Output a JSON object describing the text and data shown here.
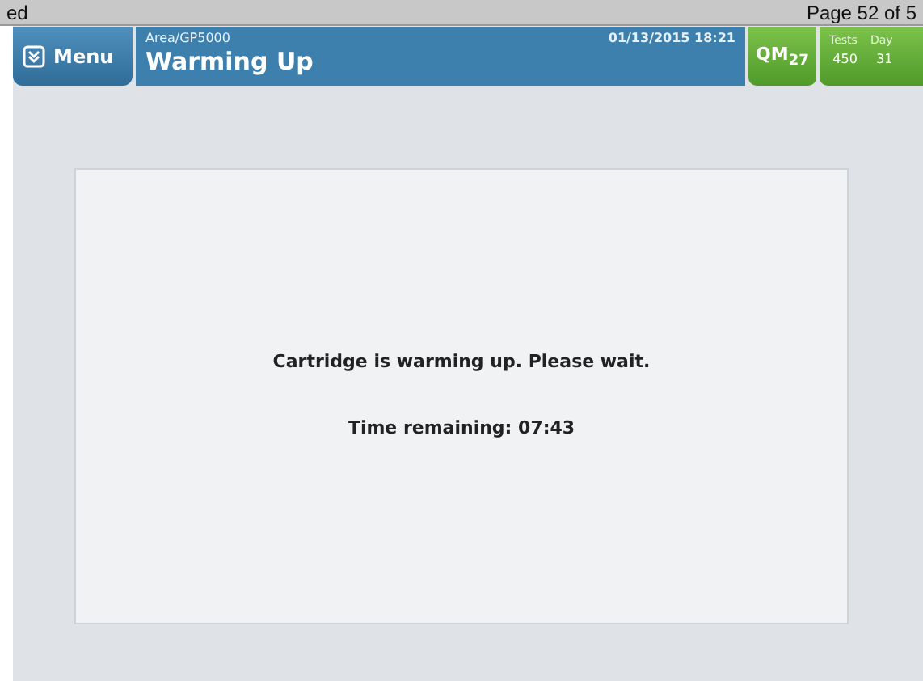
{
  "document_header": {
    "left_text": "ed",
    "right_text": "Page 52 of 5"
  },
  "header": {
    "menu_button": {
      "label": "Menu"
    },
    "subtitle": "Area/GP5000",
    "title": "Warming Up",
    "datetime": "01/13/2015 18:21",
    "qm_button": {
      "label": "QM$_{27}$"
    },
    "counters": [
      {
        "label": "Tests",
        "value": "450"
      },
      {
        "label": "Day",
        "value": "31"
      }
    ]
  },
  "panel": {
    "message": "Cartridge is warming up. Please wait.",
    "time_remaining": "Time remaining: 07:43"
  }
}
